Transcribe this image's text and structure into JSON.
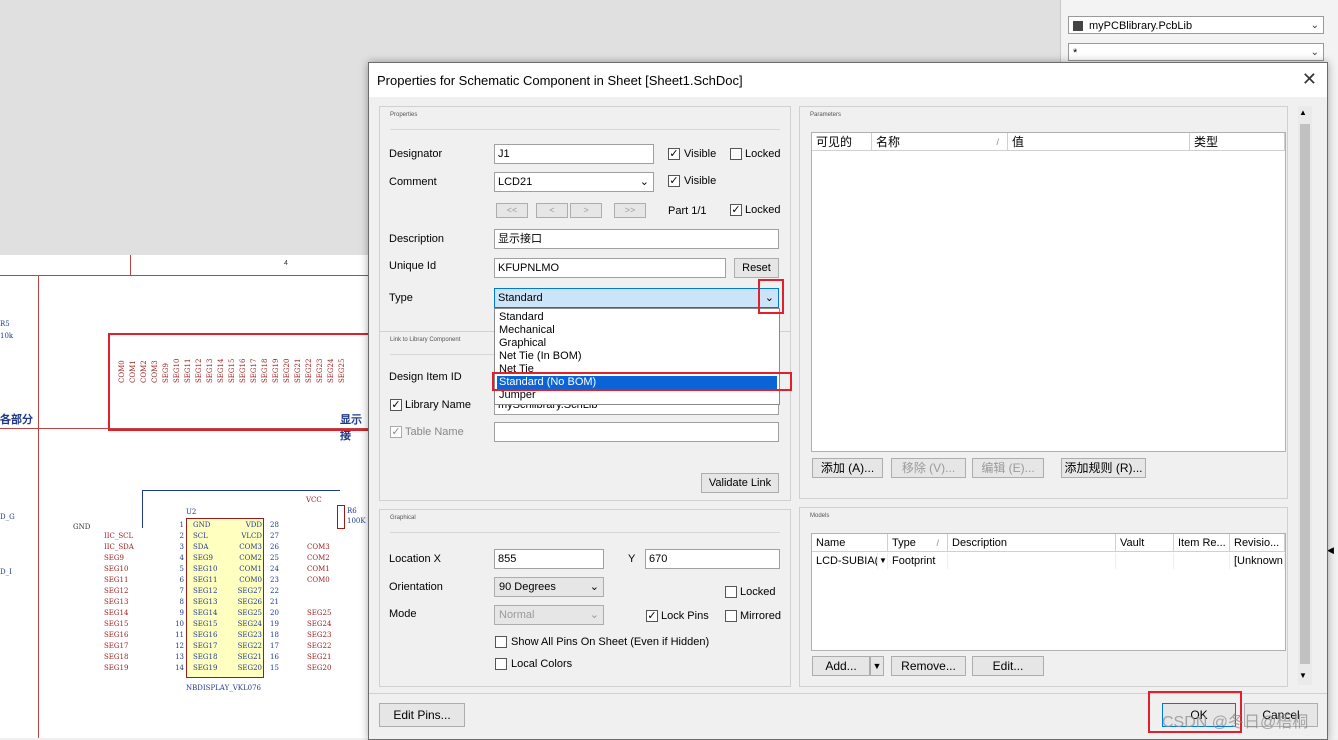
{
  "right_panel": {
    "library_combo": "myPCBlibrary.PcbLib",
    "filter_combo": "*"
  },
  "schematic": {
    "column_number": "4",
    "left_label": "各部分",
    "right_label": "显示接",
    "r5_name": "R5",
    "r5_value": "10k",
    "r6_name": "R6",
    "r6_value": "100K",
    "vcc": "VCC",
    "gnd": "GND",
    "side_labels": [
      "D_G",
      "D_I"
    ],
    "u_ref": "U2",
    "chip_name": "NBDISPLAY_VKL076",
    "vertical_nets": [
      "COM0",
      "COM1",
      "COM2",
      "COM3",
      "SEG9",
      "SEG10",
      "SEG11",
      "SEG12",
      "SEG13",
      "SEG14",
      "SEG15",
      "SEG16",
      "SEG17",
      "SEG18",
      "SEG19",
      "SEG20",
      "SEG21",
      "SEG22",
      "SEG23",
      "SEG24",
      "SEG25"
    ],
    "left_nets": [
      "IIC_SCL",
      "IIC_SDA",
      "SEG9",
      "SEG10",
      "SEG11",
      "SEG12",
      "SEG13",
      "SEG14",
      "SEG15",
      "SEG16",
      "SEG17",
      "SEG18",
      "SEG19"
    ],
    "left_pin_nums": [
      "1",
      "2",
      "3",
      "4",
      "5",
      "6",
      "7",
      "8",
      "9",
      "10",
      "11",
      "12",
      "13",
      "14"
    ],
    "left_pin_names": [
      "GND",
      "SCL",
      "SDA",
      "SEG9",
      "SEG10",
      "SEG11",
      "SEG12",
      "SEG13",
      "SEG14",
      "SEG15",
      "SEG16",
      "SEG17",
      "SEG18",
      "SEG19"
    ],
    "right_pin_names": [
      "VDD",
      "VLCD",
      "COM3",
      "COM2",
      "COM1",
      "COM0",
      "SEG27",
      "SEG26",
      "SEG25",
      "SEG24",
      "SEG23",
      "SEG22",
      "SEG21",
      "SEG20"
    ],
    "right_pin_nums": [
      "28",
      "27",
      "26",
      "25",
      "24",
      "23",
      "22",
      "21",
      "20",
      "19",
      "18",
      "17",
      "16",
      "15"
    ],
    "right_nets": [
      "",
      "",
      "COM3",
      "COM2",
      "COM1",
      "COM0",
      "",
      "",
      "SEG25",
      "SEG24",
      "SEG23",
      "SEG22",
      "SEG21",
      "SEG20"
    ]
  },
  "dialog": {
    "title": "Properties for Schematic Component in Sheet [Sheet1.SchDoc]",
    "properties": {
      "section_title": "Properties",
      "designator_label": "Designator",
      "designator_value": "J1",
      "comment_label": "Comment",
      "comment_value": "LCD21",
      "visible_label": "Visible",
      "locked_label": "Locked",
      "nav_buttons": [
        "<<",
        "<",
        ">",
        ">>"
      ],
      "part_label": "Part 1/1",
      "description_label": "Description",
      "description_value": "显示接口",
      "unique_id_label": "Unique Id",
      "unique_id_value": "KFUPNLMO",
      "reset_label": "Reset",
      "type_label": "Type",
      "type_value": "Standard",
      "type_options": [
        "Standard",
        "Mechanical",
        "Graphical",
        "Net Tie (In BOM)",
        "Net Tie",
        "Standard (No BOM)",
        "Jumper"
      ]
    },
    "link": {
      "section_title": "Link to Library Component",
      "design_item_label": "Design Item ID",
      "library_name_label": "Library Name",
      "library_name_value": "mySchlibrary.SchLib",
      "table_name_label": "Table Name",
      "validate_label": "Validate Link"
    },
    "graphical": {
      "section_title": "Graphical",
      "location_label": "Location  X",
      "x_value": "855",
      "y_label": "Y",
      "y_value": "670",
      "orientation_label": "Orientation",
      "orientation_value": "90 Degrees",
      "mode_label": "Mode",
      "mode_value": "Normal",
      "locked_label": "Locked",
      "lock_pins_label": "Lock Pins",
      "mirrored_label": "Mirrored",
      "show_all_pins_label": "Show All Pins On Sheet (Even if Hidden)",
      "local_colors_label": "Local Colors"
    },
    "parameters": {
      "section_title": "Parameters",
      "columns": [
        "可见的",
        "名称",
        "值",
        "类型"
      ],
      "sort_mark": "/",
      "add_label": "添加 (A)...",
      "remove_label": "移除 (V)...",
      "edit_label": "编辑 (E)...",
      "add_rule_label": "添加规则 (R)..."
    },
    "models": {
      "section_title": "Models",
      "columns": [
        "Name",
        "Type",
        "Description",
        "Vault",
        "Item Re...",
        "Revisio..."
      ],
      "sort_mark": "/",
      "row": {
        "name": "LCD-SUBIA(",
        "type": "Footprint",
        "description": "",
        "vault": "",
        "item": "",
        "revision": "[Unknown"
      },
      "add_label": "Add...",
      "remove_label": "Remove...",
      "edit_label": "Edit..."
    },
    "edit_pins_label": "Edit Pins...",
    "ok_label": "OK",
    "cancel_label": "Cancel"
  },
  "watermark": "CSDN @冬日@梧桐"
}
